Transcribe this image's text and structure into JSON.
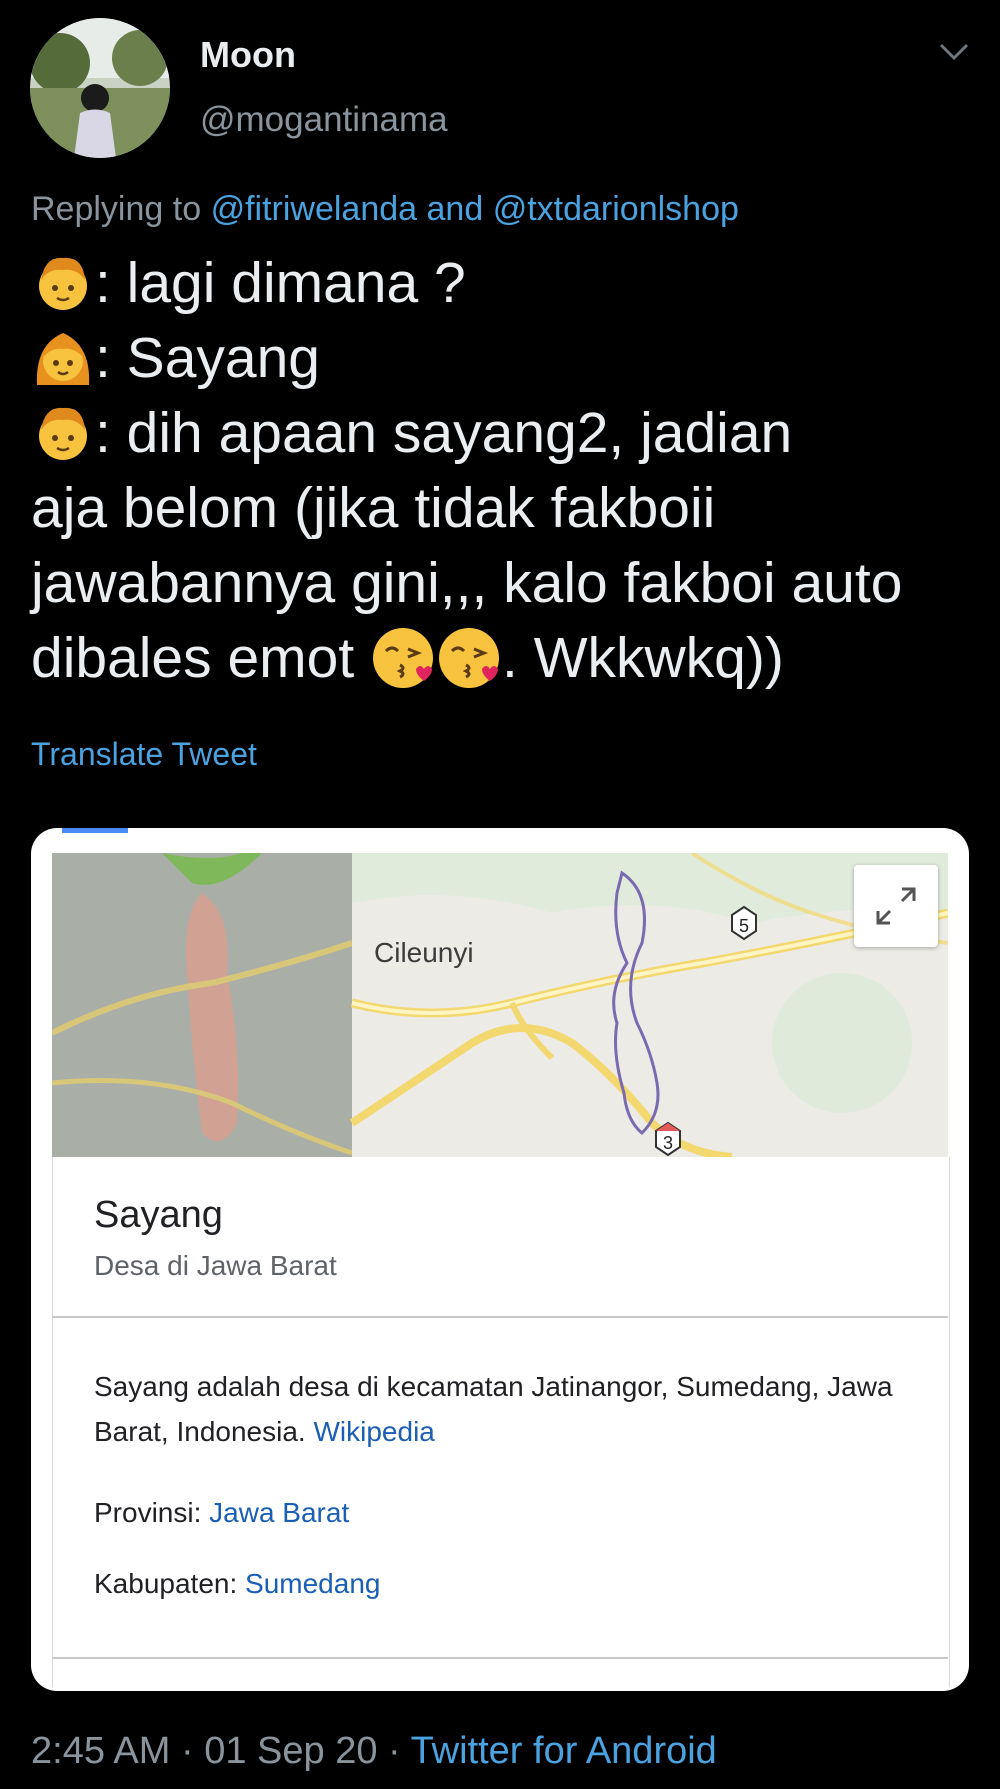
{
  "tweet": {
    "author_name": "Moon",
    "author_handle": "@mogantinama",
    "replying_prefix": "Replying to",
    "replying_user1": "@fitriwelanda",
    "replying_and": "and",
    "replying_user2": "@txtdarionlshop",
    "lines": {
      "l1": ": lagi dimana ?",
      "l2": ": Sayang",
      "l3": ": dih apaan sayang2, jadian",
      "l4": "aja belom (jika tidak fakboii",
      "l5": "jawabannya gini,,, kalo fakboi auto",
      "l6_start": "dibales emot ",
      "l6_end": ". Wkkwkq))"
    },
    "translate_label": "Translate Tweet",
    "time": "2:45 AM",
    "date": "01 Sep 20",
    "sep": "·",
    "client": "Twitter for Android"
  },
  "card": {
    "map": {
      "place_label": "Cileunyi",
      "route_a": "5",
      "route_b": "3"
    },
    "title": "Sayang",
    "subtitle": "Desa di Jawa Barat",
    "description": "Sayang adalah desa di kecamatan Jatinangor, Sumedang, Jawa Barat, Indonesia.",
    "source_link": "Wikipedia",
    "facts": [
      {
        "label": "Provinsi:",
        "value": "Jawa Barat"
      },
      {
        "label": "Kabupaten:",
        "value": "Sumedang"
      }
    ]
  },
  "colors": {
    "background": "#000000",
    "link": "#4aa3e0",
    "muted": "#8a949c",
    "card_link": "#1a5fb4"
  },
  "icons": [
    "chevron-down-icon",
    "boy-emoji-icon",
    "girl-emoji-icon",
    "kissing-face-emoji-icon",
    "expand-icon",
    "route-shield-icon"
  ]
}
